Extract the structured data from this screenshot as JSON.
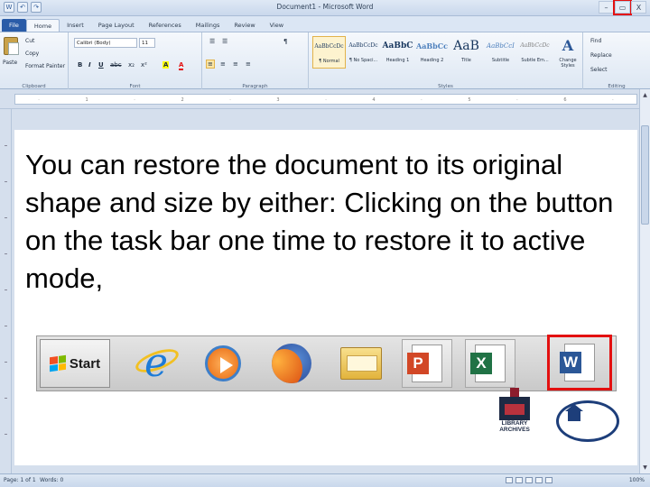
{
  "window": {
    "title": "Document1 - Microsoft Word",
    "controls": {
      "minimize": "–",
      "restore": "▭",
      "close": "X"
    },
    "highlight_color": "#e31010"
  },
  "quick_access": [
    "W",
    "↶",
    "↷"
  ],
  "tabs": [
    "File",
    "Home",
    "Insert",
    "Page Layout",
    "References",
    "Mailings",
    "Review",
    "View"
  ],
  "ribbon": {
    "clipboard": {
      "label": "Clipboard",
      "paste": "Paste",
      "cut": "Cut",
      "copy": "Copy",
      "format_painter": "Format Painter"
    },
    "font": {
      "label": "Font",
      "font_name": "Calibri (Body)",
      "font_size": "11",
      "bold": "B",
      "italic": "I",
      "underline": "U",
      "strike": "abc",
      "sub": "x₂",
      "sup": "x²",
      "highlight": "A",
      "color": "A"
    },
    "paragraph": {
      "label": "Paragraph",
      "pilcrow": "¶"
    },
    "styles": {
      "label": "Styles",
      "items": [
        {
          "preview": "AaBbCcDc",
          "name": "¶ Normal"
        },
        {
          "preview": "AaBbCcDc",
          "name": "¶ No Spaci..."
        },
        {
          "preview": "AaBbC",
          "name": "Heading 1"
        },
        {
          "preview": "AaBbCc",
          "name": "Heading 2"
        },
        {
          "preview": "AaB",
          "name": "Title"
        },
        {
          "preview": "AaBbCcI",
          "name": "Subtitle"
        },
        {
          "preview": "AaBbCcDc",
          "name": "Subtle Em..."
        }
      ],
      "change_styles": "Change Styles"
    },
    "editing": {
      "label": "Editing",
      "find": "Find",
      "replace": "Replace",
      "select": "Select"
    }
  },
  "document": {
    "body_text": "You can restore the document to its original shape and size by either: Clicking on the button on the task bar one time to restore it to active mode,"
  },
  "taskbar": {
    "start_label": "Start",
    "ppt_badge": "P",
    "excel_badge": "X",
    "word_badge": "W"
  },
  "logos": {
    "library_archives": "LIBRARY ARCHIVES"
  },
  "status_bar": {
    "page": "Page: 1 of 1",
    "words": "Words: 0",
    "zoom": "100%"
  }
}
